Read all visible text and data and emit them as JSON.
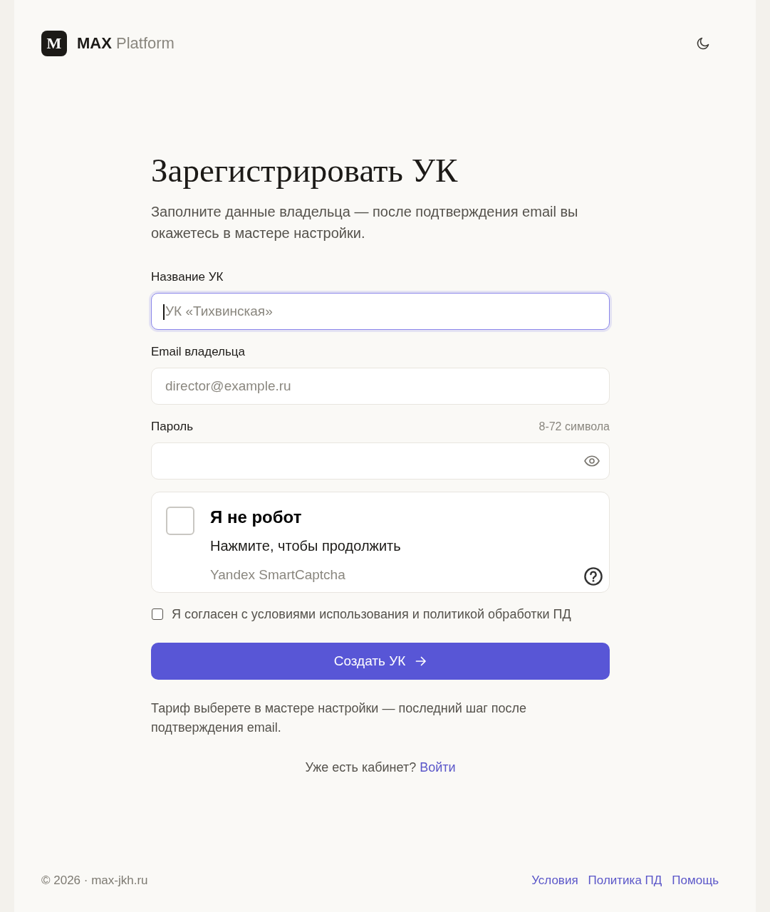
{
  "header": {
    "logo_letter": "M",
    "brand": "MAX",
    "brand_suffix": "Platform"
  },
  "form": {
    "title": "Зарегистрировать УК",
    "subtitle": "Заполните данные владельца — после подтверждения email вы окажетесь в мастере настройки.",
    "fields": [
      {
        "kind": "text",
        "label": "Название УК",
        "placeholder": "УК «Тихвинская»",
        "focused": true
      },
      {
        "kind": "email",
        "label": "Email владельца",
        "placeholder": "director@example.ru",
        "focused": false
      },
      {
        "kind": "password",
        "label": "Пароль",
        "hint": "8-72 символа",
        "focused": false
      }
    ],
    "captcha": {
      "checked": false,
      "title": "Я не робот",
      "subtitle": "Нажмите, чтобы продолжить",
      "provider": "Yandex SmartCaptcha"
    },
    "agreement": {
      "checked": false,
      "text": "Я согласен с условиями использования и политикой обработки ПД"
    },
    "submit": {
      "label": "Создать УК"
    },
    "note": "Тариф выберете в мастере настройки — последний шаг после подтверждения email.",
    "login": {
      "prompt": "Уже есть кабинет?",
      "link": "Войти"
    }
  },
  "footer": {
    "copyright": "© 2026 · max-jkh.ru",
    "links": [
      "Условия",
      "Политика ПД",
      "Помощь"
    ]
  }
}
